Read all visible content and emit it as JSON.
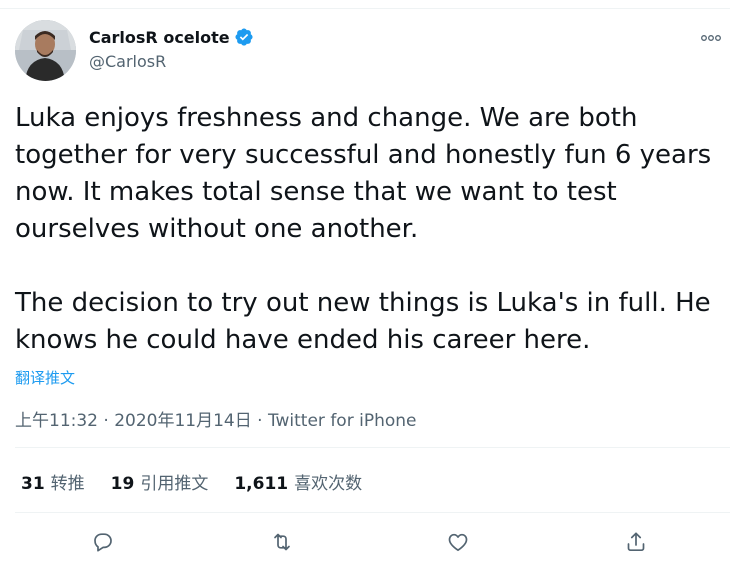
{
  "tweet": {
    "author": {
      "display_name": "CarlosR ocelote",
      "handle": "@CarlosR",
      "verified": true
    },
    "text": "Luka enjoys freshness and change. We are both together for very successful and honestly fun 6 years now. It makes total sense that we want to test ourselves without one another.\n\nThe decision to try out new things is Luka's in full. He knows he could have ended his career here.",
    "translate_label": "翻译推文",
    "meta": "上午11:32 · 2020年11月14日 · Twitter for iPhone",
    "stats": {
      "retweets_count": "31",
      "retweets_label": "转推",
      "quotes_count": "19",
      "quotes_label": "引用推文",
      "likes_count": "1,611",
      "likes_label": "喜欢次数"
    }
  },
  "colors": {
    "accent": "#1d9bf0",
    "secondary_text": "#536471",
    "divider": "#eff3f4"
  },
  "icons": {
    "more": "more-dots-icon",
    "verified": "verified-badge-icon",
    "reply": "reply-icon",
    "retweet": "retweet-icon",
    "like": "like-icon",
    "share": "share-icon"
  }
}
